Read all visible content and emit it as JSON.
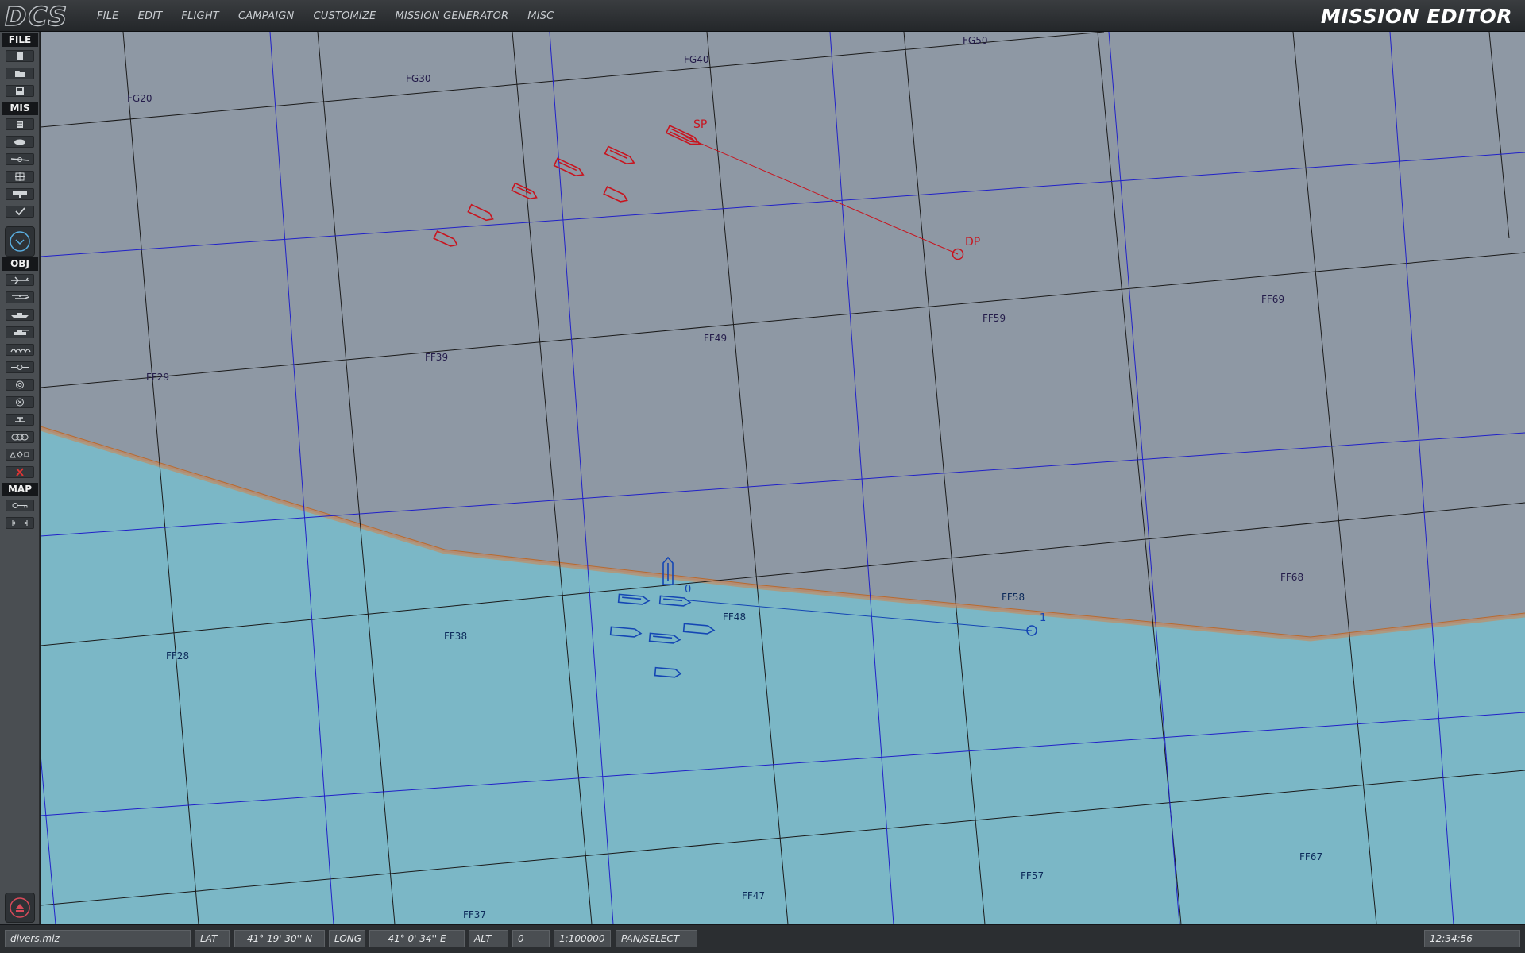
{
  "app": {
    "title": "MISSION EDITOR",
    "logo_text": "DCS"
  },
  "menu": [
    "FILE",
    "EDIT",
    "FLIGHT",
    "CAMPAIGN",
    "CUSTOMIZE",
    "MISSION GENERATOR",
    "MISC"
  ],
  "sidebar": {
    "sections": [
      "FILE",
      "MIS",
      "OBJ",
      "MAP"
    ],
    "file_icons": [
      "new-file-icon",
      "open-folder-icon",
      "save-disk-icon"
    ],
    "mis_icons": [
      "briefing-icon",
      "weather-icon",
      "trigger-icon",
      "target-icon",
      "flag-icon",
      "check-icon",
      "zoom-circle-icon"
    ],
    "obj_icons": [
      "plane-icon",
      "helicopter-icon",
      "ship-icon",
      "vehicle-icon",
      "group-icon",
      "waypoint-icon",
      "static-object-icon",
      "zone-icon",
      "template-icon",
      "bridge-icon",
      "shapes-icon",
      "delete-icon"
    ],
    "map_icons": [
      "key-icon",
      "ruler-icon"
    ],
    "bottom_icon": "eject-icon"
  },
  "map": {
    "land_color": "#8e98a4",
    "sea_color": "#7bb7c6",
    "grid_labels_land": [
      "FG20",
      "FG30",
      "FG40",
      "FG50",
      "FF29",
      "FF39",
      "FF49",
      "FF59",
      "FF69",
      "FF68"
    ],
    "grid_labels_sea": [
      "FF58",
      "FF48",
      "FF38",
      "FF28",
      "FF37",
      "FF47",
      "FF57",
      "FF67"
    ],
    "red_group": {
      "color": "#c8141e",
      "waypoint_start": "SP",
      "waypoint_end": "DP"
    },
    "blue_group": {
      "color": "#1446b4",
      "waypoint_start": "0",
      "waypoint_end": "1"
    }
  },
  "status": {
    "filename": "divers.miz",
    "lat_label": "LAT",
    "lat_value": "41° 19' 30'' N",
    "long_label": "LONG",
    "long_value": "41°  0' 34'' E",
    "alt_label": "ALT",
    "alt_value": "0",
    "scale": "1:100000",
    "mode": "PAN/SELECT",
    "time": "12:34:56"
  }
}
